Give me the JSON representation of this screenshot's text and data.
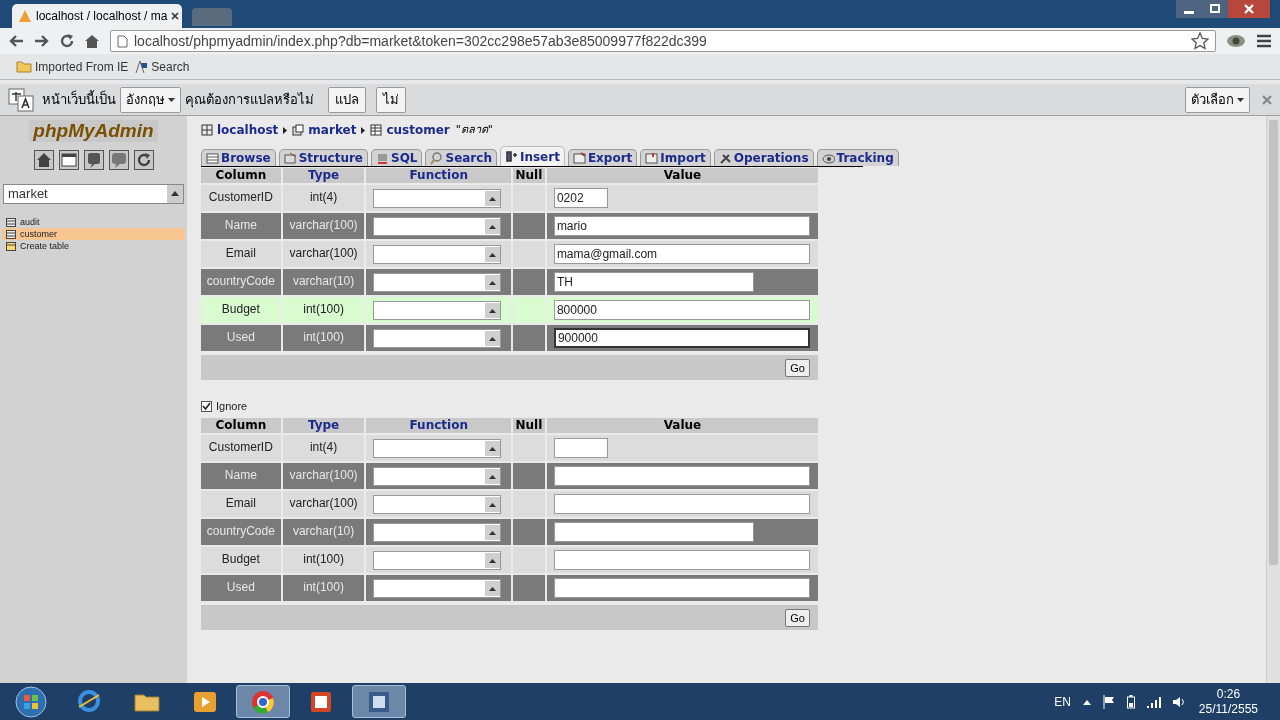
{
  "browser": {
    "tab_title": "localhost / localhost / ma",
    "address": "localhost/phpmyadmin/index.php?db=market&token=302cc298e57ab3e85009977f822dc399",
    "bookmarks": [
      "Imported From IE",
      "Search"
    ]
  },
  "translate_bar": {
    "prefix": "หน้าเว็บนี้เป็น",
    "language": "อังกฤษ",
    "question": "คุณต้องการแปลหรือไม่",
    "translate_button": "แปล",
    "no_button": "ไม่",
    "options_button": "ตัวเลือก"
  },
  "sidebar": {
    "logo": "phpMyAdmin",
    "database": "market",
    "tables": [
      {
        "label": "audit",
        "selected": false
      },
      {
        "label": "customer",
        "selected": true
      }
    ],
    "create_table": "Create table"
  },
  "breadcrumb": {
    "server": "localhost",
    "database": "market",
    "table": "customer",
    "comment": "\"ตลาด\""
  },
  "tabs": [
    {
      "label": "Browse",
      "selected": false
    },
    {
      "label": "Structure",
      "selected": false
    },
    {
      "label": "SQL",
      "selected": false
    },
    {
      "label": "Search",
      "selected": false
    },
    {
      "label": "Insert",
      "selected": true
    },
    {
      "label": "Export",
      "selected": false
    },
    {
      "label": "Import",
      "selected": false
    },
    {
      "label": "Operations",
      "selected": false
    },
    {
      "label": "Tracking",
      "selected": false
    }
  ],
  "forms": [
    {
      "columns": [
        "Column",
        "Type",
        "Function",
        "Null",
        "Value"
      ],
      "rows": [
        {
          "column": "CustomerID",
          "type": "int(4)",
          "kind": "narrow",
          "value": "0202",
          "hover": false,
          "focused": false
        },
        {
          "column": "Name",
          "type": "varchar(100)",
          "kind": "wide",
          "value": "mario",
          "hover": false,
          "focused": false
        },
        {
          "column": "Email",
          "type": "varchar(100)",
          "kind": "wide",
          "value": "mama@gmail.com",
          "hover": false,
          "focused": false
        },
        {
          "column": "countryCode",
          "type": "varchar(10)",
          "kind": "medium",
          "value": "TH",
          "hover": false,
          "focused": false
        },
        {
          "column": "Budget",
          "type": "int(100)",
          "kind": "wide",
          "value": "800000",
          "hover": true,
          "focused": false
        },
        {
          "column": "Used",
          "type": "int(100)",
          "kind": "wide",
          "value": "900000",
          "hover": false,
          "focused": true
        }
      ],
      "go": "Go"
    },
    {
      "ignore": {
        "label": "Ignore",
        "checked": true
      },
      "columns": [
        "Column",
        "Type",
        "Function",
        "Null",
        "Value"
      ],
      "rows": [
        {
          "column": "CustomerID",
          "type": "int(4)",
          "kind": "narrow",
          "hover": false,
          "focused": false
        },
        {
          "column": "Name",
          "type": "varchar(100)",
          "kind": "wide",
          "hover": false,
          "focused": false
        },
        {
          "column": "Email",
          "type": "varchar(100)",
          "kind": "wide",
          "hover": false,
          "focused": false
        },
        {
          "column": "countryCode",
          "type": "varchar(10)",
          "kind": "medium",
          "hover": false,
          "focused": false
        },
        {
          "column": "Budget",
          "type": "int(100)",
          "kind": "wide",
          "hover": false,
          "focused": false
        },
        {
          "column": "Used",
          "type": "int(100)",
          "kind": "wide",
          "hover": false,
          "focused": false
        }
      ],
      "go": "Go"
    }
  ],
  "taskbar": {
    "apps": [
      {
        "kind": "ie",
        "selected": false
      },
      {
        "kind": "folder",
        "selected": false
      },
      {
        "kind": "media",
        "selected": false
      },
      {
        "kind": "chrome",
        "selected": true
      },
      {
        "kind": "slides",
        "selected": false
      },
      {
        "kind": "film",
        "selected": true
      }
    ],
    "language": "EN",
    "time": "0:26",
    "date": "25/11/2555"
  }
}
